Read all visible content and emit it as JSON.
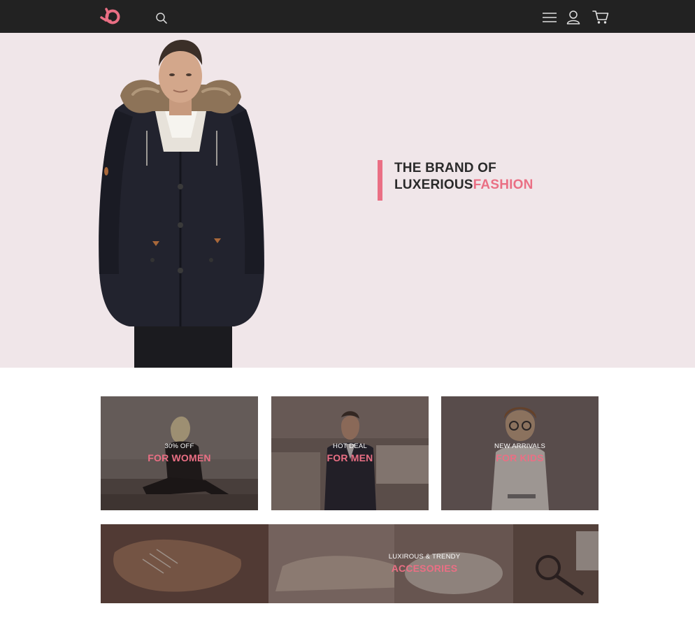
{
  "header": {
    "icons": {
      "logo": "brand-logo-icon",
      "search": "search-icon",
      "menu": "hamburger-menu-icon",
      "account": "user-icon",
      "cart": "cart-icon"
    },
    "background": "#222222"
  },
  "hero": {
    "headline_line1": "THE BRAND OF",
    "headline_line2_main": "LUXERIOUS",
    "headline_line2_accent": "FASHION",
    "background": "#f0e6e9",
    "accent_color": "#ea6f84"
  },
  "categories": [
    {
      "kicker": "30% OFF",
      "title": "FOR WOMEN"
    },
    {
      "kicker": "HOT DEAL",
      "title": "FOR MEN"
    },
    {
      "kicker": "NEW ARRIVALS",
      "title": "FOR KIDS"
    }
  ],
  "banner": {
    "kicker": "LUXIROUS & TRENDY",
    "title": "ACCESORIES"
  }
}
